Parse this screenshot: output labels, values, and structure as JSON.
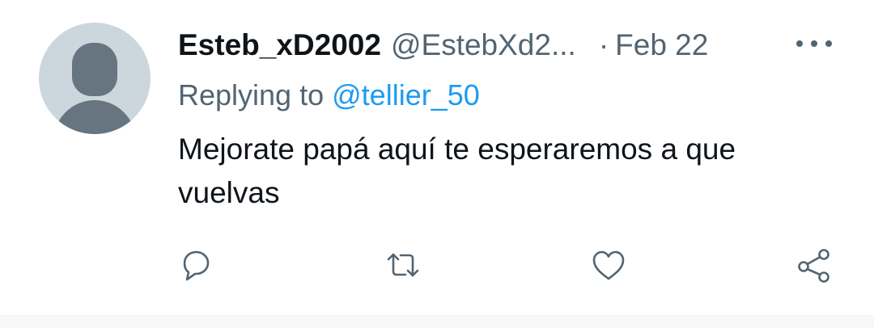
{
  "tweet": {
    "display_name": "Esteb_xD2002",
    "handle": "@EstebXd2...",
    "separator": "·",
    "date": "Feb 22",
    "replying_to_label": "Replying to",
    "replying_to_handle": "@tellier_50",
    "text": "Mejorate papá aquí te esperaremos a que vuelvas"
  },
  "icons": {
    "avatar": "default-avatar-icon",
    "more": "more-options-icon",
    "reply": "reply-icon",
    "retweet": "retweet-icon",
    "like": "like-icon",
    "share": "share-icon"
  },
  "colors": {
    "primary_text": "#0f1419",
    "secondary_text": "#536471",
    "mention": "#1d9bf0",
    "avatar_bg": "#ccd6dd",
    "avatar_fg": "#66757f"
  }
}
